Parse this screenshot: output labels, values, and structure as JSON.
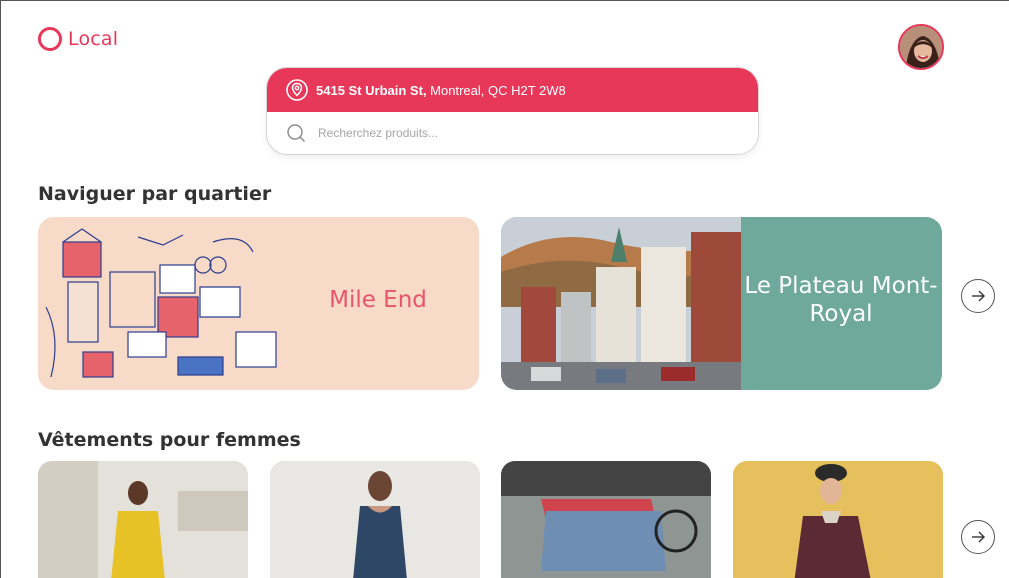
{
  "app": {
    "name": "Local",
    "accent": "#e8385a"
  },
  "address": {
    "street": "5415 St Urbain St,",
    "city": "Montreal, QC H2T 2W8"
  },
  "search": {
    "placeholder": "Recherchez produits..."
  },
  "sections": {
    "neighbourhoods": {
      "title": "Naviguer par quartier",
      "cards": [
        {
          "label": "Mile End",
          "color": "#f8dac8"
        },
        {
          "label": "Le Plateau Mont-Royal",
          "color": "#6ea99b"
        }
      ]
    },
    "womens": {
      "title": "Vêtements pour femmes",
      "products": [
        {
          "icon": "product-photo"
        },
        {
          "icon": "product-photo"
        },
        {
          "icon": "product-photo"
        },
        {
          "icon": "product-photo"
        }
      ]
    }
  },
  "icons": {
    "pin": "location-pin-icon",
    "search": "search-icon",
    "next": "arrow-right-icon"
  }
}
